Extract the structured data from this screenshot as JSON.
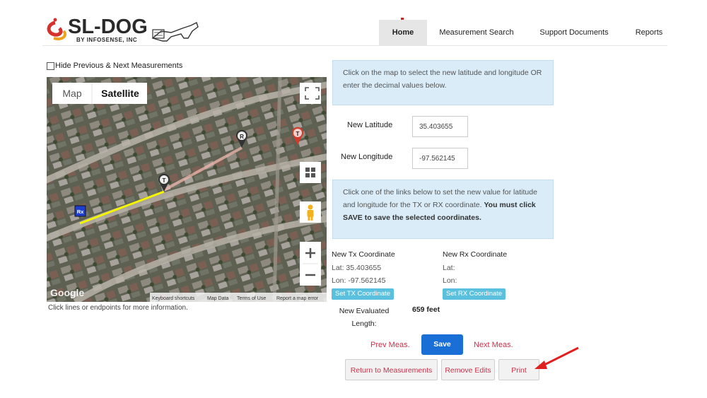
{
  "header": {
    "logo_text": "SL-DOG",
    "logo_sub": "BY INFOSENSE, INC",
    "nav": [
      "Home",
      "Measurement Search",
      "Support Documents",
      "Reports"
    ]
  },
  "left": {
    "hide_label": "Hide Previous & Next Measurements",
    "map": {
      "tab_map": "Map",
      "tab_satellite": "Satellite",
      "google": "Google",
      "footer": [
        "Keyboard shortcuts",
        "Map Data",
        "Terms of Use",
        "Report a map error"
      ],
      "marker_tx": "T",
      "marker_rx": "R",
      "marker_rx_box": "Rx",
      "line_color": "#f5f500"
    },
    "hint": "Click lines or endpoints for more information."
  },
  "right": {
    "info1": "Click on the map to select the new latitude and longitude OR enter the decimal values below.",
    "lat_label": "New Latitude",
    "lat_value": "35.403655",
    "lon_label": "New Longitude",
    "lon_value": "-97.562145",
    "info2_plain": "Click one of the links below to set the new value for latitude and longitude for the TX or RX coordinate. ",
    "info2_bold": "You must click SAVE to save the selected coordinates.",
    "tx": {
      "head": "New Tx Coordinate",
      "lat": "Lat: 35.403655",
      "lon": "Lon: -97.562145",
      "button": "Set TX Coordinate"
    },
    "rx": {
      "head": "New Rx Coordinate",
      "lat": "Lat:",
      "lon": "Lon:",
      "button": "Set RX Coordinate"
    },
    "eval_label": "New Evaluated Length:",
    "eval_value": "659 feet",
    "prev": "Prev Meas.",
    "save": "Save",
    "next": "Next Meas.",
    "return": "Return to Measurements",
    "remove": "Remove Edits",
    "print": "Print"
  },
  "colors": {
    "accent_blue": "#1a6fd6",
    "link_red": "#c9314a",
    "info_bg": "#d9ecf8",
    "set_btn": "#5bc0de",
    "arrow": "#e02020"
  }
}
